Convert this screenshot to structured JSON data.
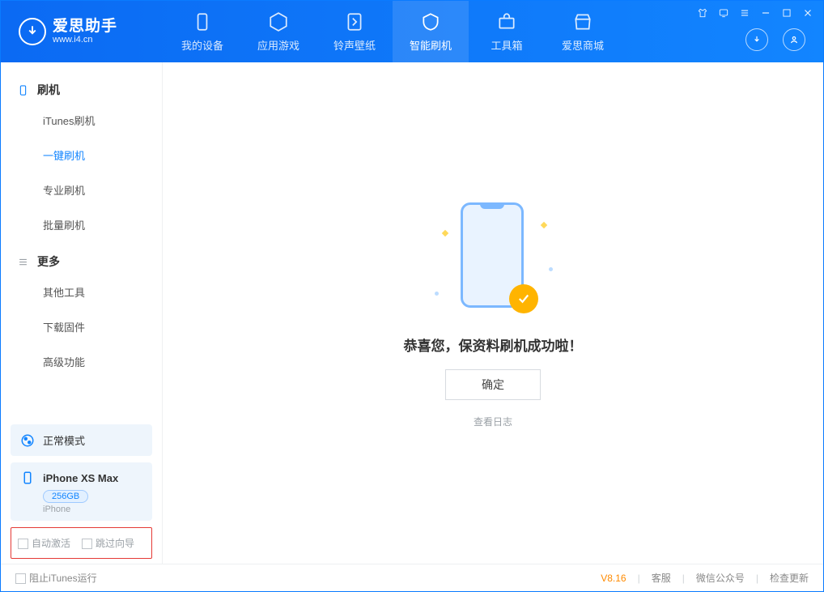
{
  "header": {
    "app_title": "爱思助手",
    "app_url": "www.i4.cn",
    "nav": [
      "我的设备",
      "应用游戏",
      "铃声壁纸",
      "智能刷机",
      "工具箱",
      "爱思商城"
    ]
  },
  "sidebar": {
    "sections": [
      {
        "title": "刷机",
        "items": [
          "iTunes刷机",
          "一键刷机",
          "专业刷机",
          "批量刷机"
        ]
      },
      {
        "title": "更多",
        "items": [
          "其他工具",
          "下载固件",
          "高级功能"
        ]
      }
    ],
    "mode": "正常模式",
    "device": {
      "name": "iPhone XS Max",
      "storage": "256GB",
      "type": "iPhone"
    },
    "options": [
      "自动激活",
      "跳过向导"
    ]
  },
  "main": {
    "success_text": "恭喜您，保资料刷机成功啦！",
    "confirm_label": "确定",
    "view_log": "查看日志"
  },
  "footer": {
    "block_itunes": "阻止iTunes运行",
    "version": "V8.16",
    "links": [
      "客服",
      "微信公众号",
      "检查更新"
    ]
  }
}
